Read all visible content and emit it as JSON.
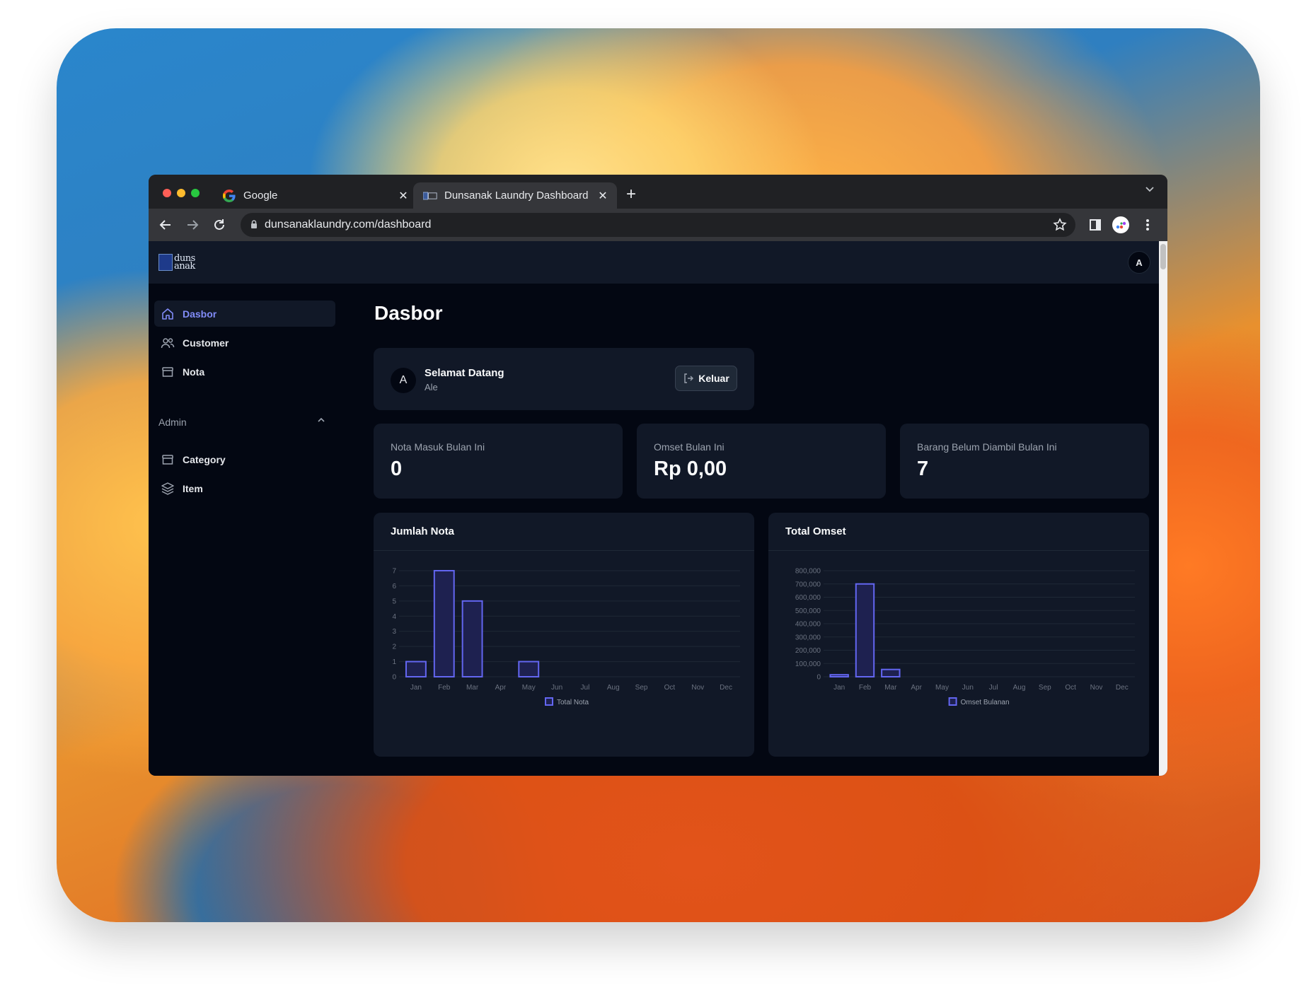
{
  "browser": {
    "tabs": [
      {
        "title": "Google",
        "favicon": "google-g-icon"
      },
      {
        "title": "Dunsanak Laundry Dashboard",
        "favicon": "dunsanak-logo-icon",
        "active": true
      }
    ],
    "url": "dunsanaklaundry.com/dashboard"
  },
  "header": {
    "logo_text": [
      "duns",
      "anak"
    ],
    "avatar": "A"
  },
  "sidebar": {
    "items": [
      {
        "label": "Dasbor",
        "icon": "home-icon",
        "active": true
      },
      {
        "label": "Customer",
        "icon": "users-icon"
      },
      {
        "label": "Nota",
        "icon": "archive-icon"
      }
    ],
    "admin_label": "Admin",
    "admin_items": [
      {
        "label": "Category",
        "icon": "archive-icon"
      },
      {
        "label": "Item",
        "icon": "layers-icon"
      }
    ]
  },
  "main": {
    "title": "Dasbor",
    "welcome": {
      "avatar": "A",
      "title": "Selamat Datang",
      "name": "Ale",
      "logout_label": "Keluar"
    },
    "stats": [
      {
        "label": "Nota Masuk Bulan Ini",
        "value": "0"
      },
      {
        "label": "Omset Bulan Ini",
        "value": "Rp 0,00"
      },
      {
        "label": "Barang Belum Diambil Bulan Ini",
        "value": "7"
      }
    ]
  },
  "colors": {
    "accent": "#818cf8",
    "bar_fill": "#1e2150",
    "bar_stroke": "#6366f1",
    "page_bg": "#030712",
    "card_bg": "#111827"
  },
  "chart_data": [
    {
      "type": "bar",
      "title": "Jumlah Nota",
      "categories": [
        "Jan",
        "Feb",
        "Mar",
        "Apr",
        "May",
        "Jun",
        "Jul",
        "Aug",
        "Sep",
        "Oct",
        "Nov",
        "Dec"
      ],
      "series": [
        {
          "name": "Total Nota",
          "values": [
            1,
            7,
            5,
            0,
            1,
            0,
            0,
            0,
            0,
            0,
            0,
            0
          ]
        }
      ],
      "ylim": [
        0,
        7
      ],
      "yticks": [
        "0",
        "1",
        "2",
        "3",
        "4",
        "5",
        "6",
        "7"
      ],
      "grid": true,
      "legend": "bottom"
    },
    {
      "type": "bar",
      "title": "Total Omset",
      "categories": [
        "Jan",
        "Feb",
        "Mar",
        "Apr",
        "May",
        "Jun",
        "Jul",
        "Aug",
        "Sep",
        "Oct",
        "Nov",
        "Dec"
      ],
      "series": [
        {
          "name": "Omset Bulanan",
          "values": [
            15000,
            700000,
            55000,
            0,
            0,
            0,
            0,
            0,
            0,
            0,
            0,
            0
          ]
        }
      ],
      "ylim": [
        0,
        800000
      ],
      "yticks": [
        "0",
        "100,000",
        "200,000",
        "300,000",
        "400,000",
        "500,000",
        "600,000",
        "700,000",
        "800,000"
      ],
      "grid": true,
      "legend": "bottom"
    }
  ]
}
